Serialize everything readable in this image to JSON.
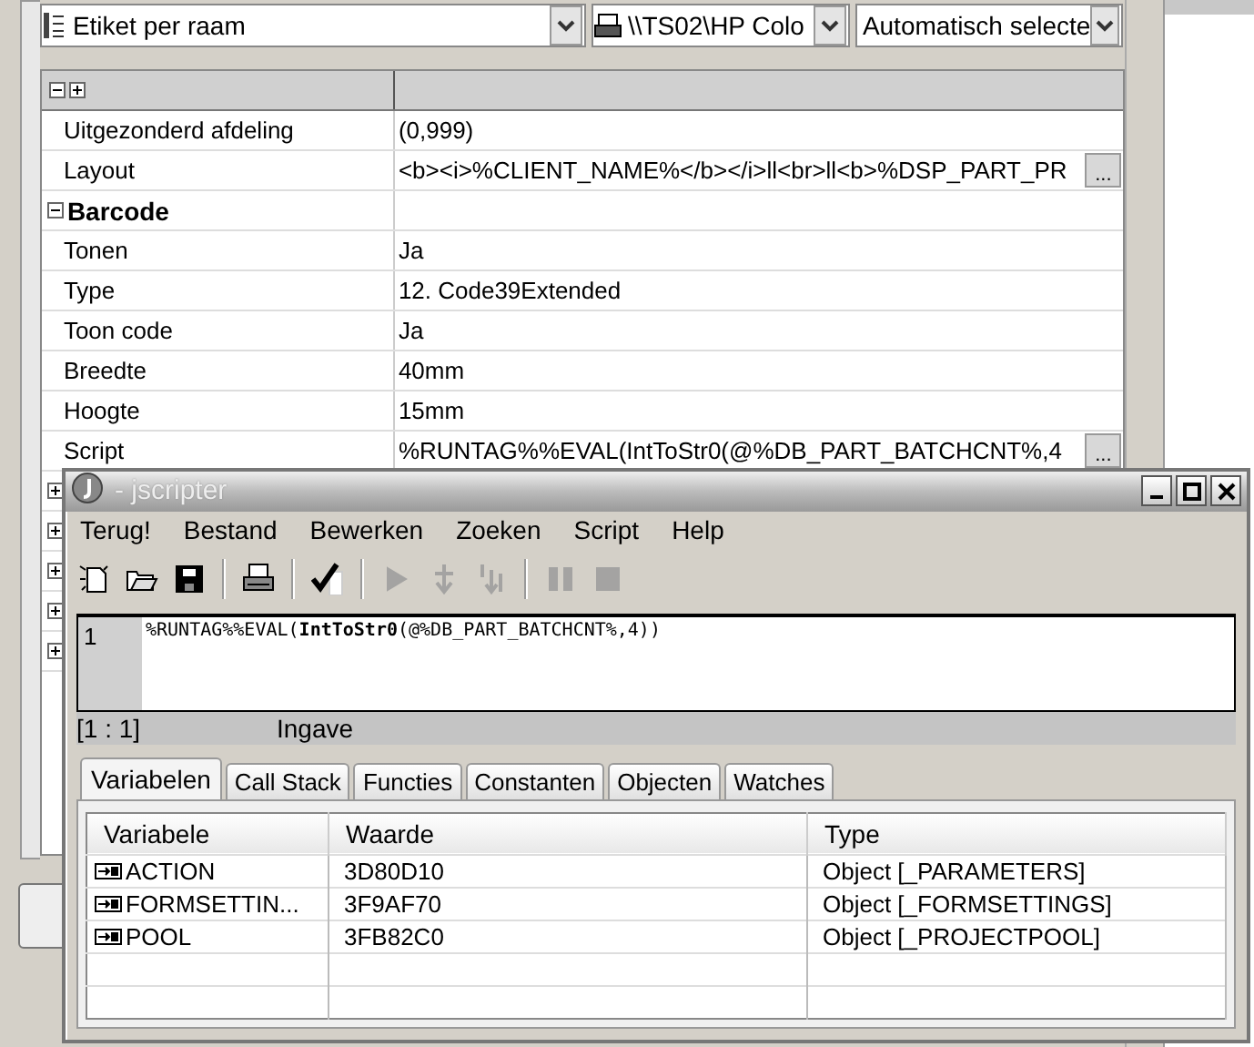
{
  "toolbar": {
    "layout_combo": "Etiket per raam",
    "printer_combo": "\\\\TS02\\HP Colo",
    "tray_combo": "Automatisch selecte"
  },
  "properties": {
    "rows": [
      {
        "kind": "prop",
        "label": "Uitgezonderd afdeling",
        "value": "(0,999)"
      },
      {
        "kind": "prop",
        "label": "Layout",
        "value": "<b><i>%CLIENT_NAME%</b></i>ll<br>ll<b>%DSP_PART_PR",
        "button": "..."
      },
      {
        "kind": "category",
        "label": "Barcode",
        "expanded": true
      },
      {
        "kind": "prop",
        "label": "Tonen",
        "value": "Ja"
      },
      {
        "kind": "prop",
        "label": "Type",
        "value": "12. Code39Extended"
      },
      {
        "kind": "prop",
        "label": "Toon code",
        "value": "Ja"
      },
      {
        "kind": "prop",
        "label": "Breedte",
        "value": "40mm"
      },
      {
        "kind": "prop",
        "label": "Hoogte",
        "value": "15mm"
      },
      {
        "kind": "prop",
        "label": "Script",
        "value": "%RUNTAG%%EVAL(IntToStr0(@%DB_PART_BATCHCNT%,4",
        "button": "..."
      },
      {
        "kind": "group",
        "expanded": false
      },
      {
        "kind": "group",
        "expanded": false
      },
      {
        "kind": "group",
        "expanded": false
      },
      {
        "kind": "group",
        "expanded": false
      },
      {
        "kind": "group",
        "expanded": false
      }
    ]
  },
  "jscripter": {
    "title": "- jscripter",
    "menu": [
      "Terug!",
      "Bestand",
      "Bewerken",
      "Zoeken",
      "Script",
      "Help"
    ],
    "tools": [
      {
        "kind": "new",
        "disabled": false
      },
      {
        "kind": "open",
        "disabled": false
      },
      {
        "kind": "save",
        "disabled": false
      },
      {
        "kind": "sep"
      },
      {
        "kind": "print",
        "disabled": false
      },
      {
        "kind": "sep"
      },
      {
        "kind": "check",
        "disabled": false
      },
      {
        "kind": "sep"
      },
      {
        "kind": "run",
        "disabled": true
      },
      {
        "kind": "step-into",
        "disabled": true
      },
      {
        "kind": "step-over",
        "disabled": true
      },
      {
        "kind": "sep"
      },
      {
        "kind": "pause",
        "disabled": true
      },
      {
        "kind": "stop",
        "disabled": true
      }
    ],
    "editor": {
      "lines": [
        {
          "number": "1",
          "code": "%RUNTAG%%EVAL(**IntToStr0**(@%DB_PART_BATCHCNT%,4))"
        }
      ]
    },
    "status": {
      "position": "[1 : 1]",
      "mode": "Ingave"
    },
    "tabs": [
      {
        "label": "Variabelen",
        "selected": true
      },
      {
        "label": "Call Stack",
        "selected": false
      },
      {
        "label": "Functies",
        "selected": false
      },
      {
        "label": "Constanten",
        "selected": false
      },
      {
        "label": "Objecten",
        "selected": false
      },
      {
        "label": "Watches",
        "selected": false
      }
    ],
    "variables": {
      "columns": [
        "Variabele",
        "Waarde",
        "Type"
      ],
      "rows": [
        [
          "ACTION",
          "3D80D10",
          "Object [_PARAMETERS]"
        ],
        [
          "FORMSETTIN...",
          "3F9AF70",
          "Object [_FORMSETTINGS]"
        ],
        [
          "POOL",
          "3FB82C0",
          "Object [_PROJECTPOOL]"
        ]
      ]
    }
  }
}
